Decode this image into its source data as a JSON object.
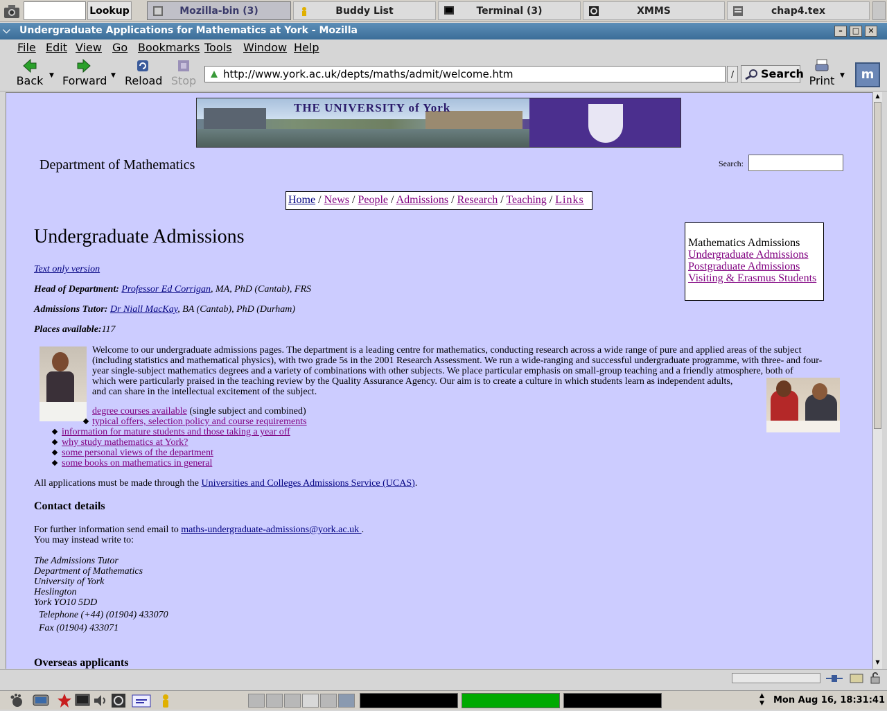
{
  "panel": {
    "lookup_label": "Lookup",
    "tasks": [
      {
        "label": "Mozilla-bin (3)"
      },
      {
        "label": "Buddy List"
      },
      {
        "label": "Terminal (3)"
      },
      {
        "label": "XMMS"
      },
      {
        "label": "chap4.tex"
      }
    ],
    "clock": "Mon Aug 16, 18:31:41"
  },
  "window": {
    "title": "Undergraduate Applications for Mathematics at York - Mozilla"
  },
  "menu": [
    "File",
    "Edit",
    "View",
    "Go",
    "Bookmarks",
    "Tools",
    "Window",
    "Help"
  ],
  "toolbar": {
    "back": "Back",
    "forward": "Forward",
    "reload": "Reload",
    "stop": "Stop",
    "url": "http://www.york.ac.uk/depts/maths/admit/welcome.htm",
    "search": "Search",
    "print": "Print"
  },
  "page": {
    "banner_title": "THE UNIVERSITY of York",
    "department": "Department of Mathematics",
    "search_label": "Search:",
    "nav": [
      "Home",
      "News",
      "People",
      "Admissions",
      "Research",
      "Teaching",
      "Links"
    ],
    "heading": "Undergraduate Admissions",
    "sidebox": {
      "title": "Mathematics Admissions",
      "links": [
        "Undergraduate Admissions",
        "Postgraduate Admissions",
        "Visiting & Erasmus Students"
      ]
    },
    "text_only": "Text only version",
    "hod_label": "Head of Department:",
    "hod_name": "Professor Ed Corrigan",
    "hod_quals": ", MA, PhD (Cantab), FRS",
    "tutor_label": "Admissions Tutor:",
    "tutor_name": "Dr Niall MacKay",
    "tutor_quals": ", BA (Cantab), PhD (Durham)",
    "places_label": "Places available:",
    "places_value": "117",
    "welcome_1": "Welcome to our undergraduate admissions pages. The department is a leading centre for mathematics, conducting research across a wide range of pure and applied areas of the subject (including statistics and mathematical physics), with two grade 5s in the 2001 Research Assessment. We run a wide-ranging and successful undergraduate programme, with three- and four-year single-subject mathematics degrees and a variety of combinations with other subjects. We place particular emphasis on small-group teaching and a friendly atmosphere, both of",
    "welcome_2": "which were particularly praised in the teaching review by the Quality Assurance Agency. Our aim is to create a culture in which students learn as independent adults, and can share in the intellectual excitement of the subject.",
    "bullets": [
      {
        "link": "degree courses available",
        "after": " (single subject and combined)"
      },
      {
        "link": "typical offers, selection policy and course requirements",
        "after": ""
      },
      {
        "link": "information for mature students and those taking a year off",
        "after": ""
      },
      {
        "link": "why study mathematics at York?",
        "after": ""
      },
      {
        "link": "some personal views of the department",
        "after": ""
      },
      {
        "link": "some books on mathematics in general",
        "after": ""
      }
    ],
    "ucas_before": "All applications must be made through the ",
    "ucas_link": "Universities and Colleges Admissions Service (UCAS)",
    "ucas_after": ".",
    "contact_heading": "Contact details",
    "email_before": "For further information send email to ",
    "email_link": "maths-undergraduate-admissions@york.ac.uk ",
    "email_after": ".",
    "write_to": "You may instead write to:",
    "address": [
      "The Admissions Tutor",
      "Department of Mathematics",
      "University of York",
      "Heslington",
      "York YO10 5DD"
    ],
    "telephone": "Telephone (+44) (01904) 433070",
    "fax": "Fax (01904) 433071",
    "overseas_heading": "Overseas applicants"
  },
  "colors": {
    "page_background": "#ccccff",
    "link": "#000080",
    "visited_link": "#800080",
    "titlebar": "#3b6d98"
  }
}
